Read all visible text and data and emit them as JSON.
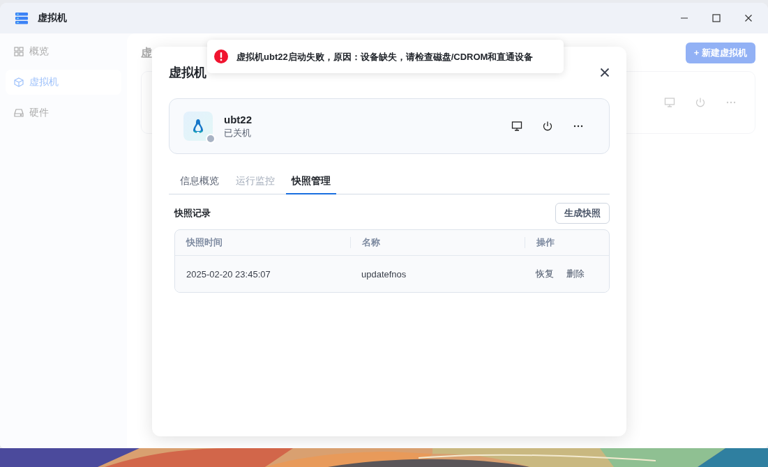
{
  "window": {
    "title": "虚拟机"
  },
  "sidebar": {
    "items": [
      {
        "label": "概览",
        "selected": false
      },
      {
        "label": "虚拟机",
        "selected": true
      },
      {
        "label": "硬件",
        "selected": false
      }
    ]
  },
  "page": {
    "heading": "虚",
    "new_button": "+ 新建虚拟机"
  },
  "dialog": {
    "title": "虚拟机",
    "vm": {
      "name": "ubt22",
      "status": "已关机",
      "running": false
    },
    "tabs": [
      {
        "label": "信息概览",
        "selected": false,
        "disabled": false
      },
      {
        "label": "运行监控",
        "selected": false,
        "disabled": true
      },
      {
        "label": "快照管理",
        "selected": true,
        "disabled": false
      }
    ],
    "section_title": "快照记录",
    "create_button": "生成快照",
    "table": {
      "columns": [
        "快照时间",
        "名称",
        "操作"
      ],
      "rows": [
        {
          "time": "2025-02-20 23:45:07",
          "name": "updatefnos",
          "actions": [
            "恢复",
            "删除"
          ]
        }
      ]
    }
  },
  "toast": {
    "kind": "error",
    "message": "虚拟机ubt22启动失败，原因：设备缺失，请检查磁盘/CDROM和直通设备"
  }
}
